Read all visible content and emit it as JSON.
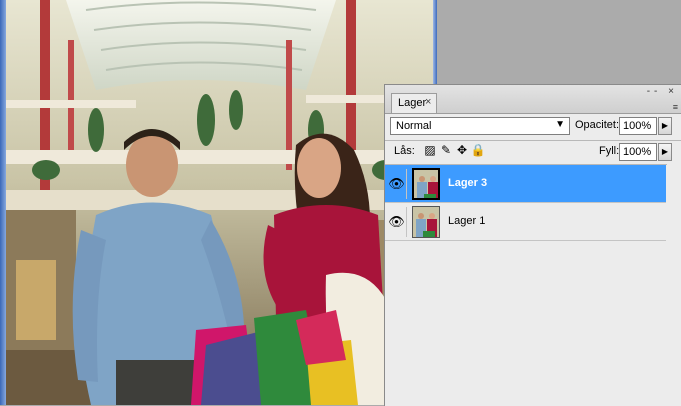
{
  "layers_panel": {
    "tab_label": "Lager",
    "tab_close_icon": "close-icon",
    "panel_buttons": "-- ×",
    "panel_menu_icon": "≡",
    "blend_mode": "Normal",
    "opacity_label": "Opacitet:",
    "opacity_value": "100%",
    "lock_label": "Lås:",
    "lock_icons": [
      "lock-transparent-pixels-icon",
      "lock-image-pixels-icon",
      "lock-position-icon",
      "lock-all-icon"
    ],
    "fill_label": "Fyll:",
    "fill_value": "100%",
    "layers": [
      {
        "name": "Lager 3",
        "selected": true,
        "visible": true
      },
      {
        "name": "Lager 1",
        "selected": false,
        "visible": true
      }
    ]
  },
  "colors": {
    "selection_blue": "#3d9bff",
    "window_frame_blue": "#3d6bbd",
    "workspace_gray": "#ababab"
  }
}
